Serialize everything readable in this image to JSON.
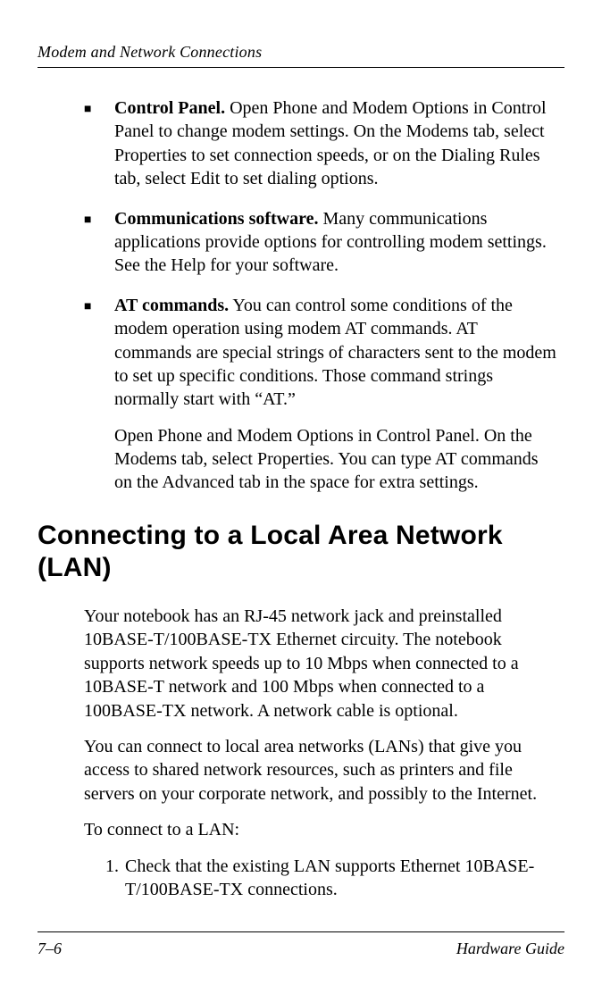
{
  "running_head": "Modem and Network Connections",
  "bullets": [
    {
      "bold": "Control Panel.",
      "text": " Open Phone and Modem Options in Control Panel to change modem settings. On the Modems tab, select Properties to set connection speeds, or on the Dialing Rules tab, select Edit to set dialing options."
    },
    {
      "bold": "Communications software.",
      "text": " Many communications applications provide options for controlling modem settings. See the Help for your software."
    },
    {
      "bold": "AT commands.",
      "text": " You can control some conditions of the modem operation using modem AT commands. AT commands are special strings of characters sent to the modem to set up specific conditions. Those command strings normally start with “AT.”",
      "follow": "Open Phone and Modem Options in Control Panel. On the Modems tab, select Properties. You can type AT commands on the Advanced tab in the space for extra settings."
    }
  ],
  "heading": "Connecting to a Local Area Network (LAN)",
  "paras": [
    "Your notebook has an RJ-45 network jack and preinstalled 10BASE-T/100BASE-TX Ethernet circuity. The notebook supports network speeds up to 10 Mbps when connected to a 10BASE-T network and 100 Mbps when connected to a 100BASE-TX network. A network cable is optional.",
    "You can connect to local area networks (LANs) that give you access to shared network resources, such as printers and file servers on your corporate network, and possibly to the Internet.",
    "To connect to a LAN:"
  ],
  "ordered": {
    "num": "1.",
    "text": "Check that the existing LAN supports Ethernet 10BASE-T/100BASE-TX connections."
  },
  "footer": {
    "left": "7–6",
    "right": "Hardware Guide"
  }
}
